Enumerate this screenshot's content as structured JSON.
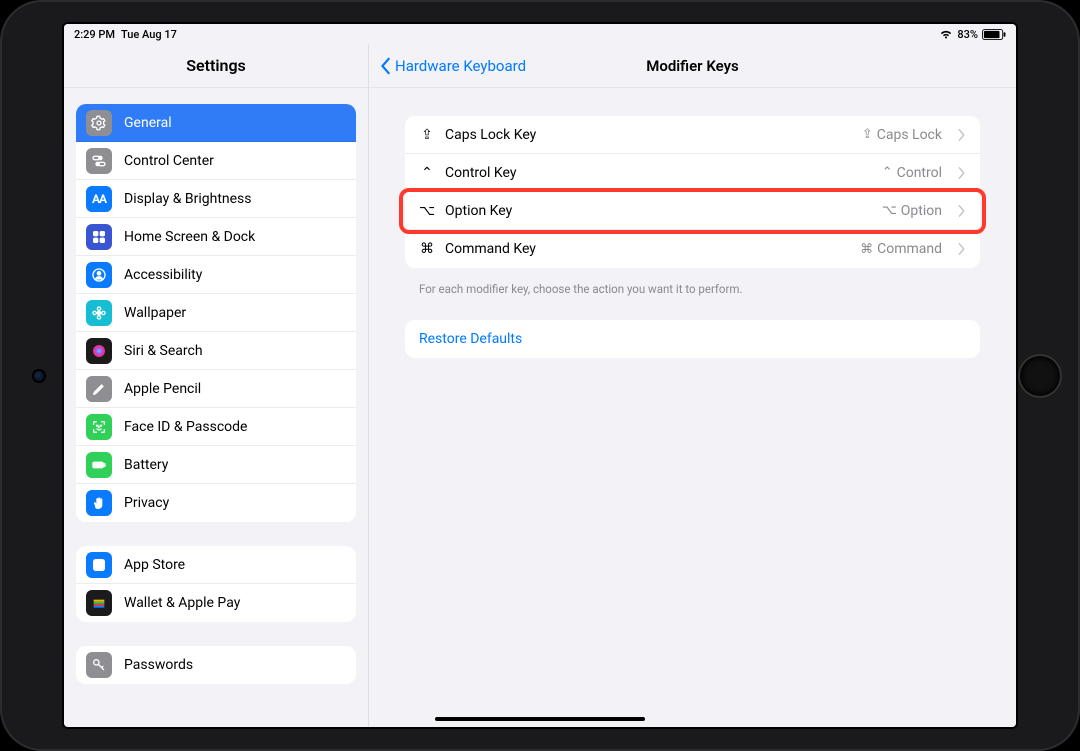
{
  "status": {
    "time": "2:29 PM",
    "date": "Tue Aug 17",
    "battery_text": "83%"
  },
  "sidebar": {
    "title": "Settings",
    "group1": [
      {
        "label": "General",
        "icon": "gear",
        "bg": "#8e8e93",
        "selected": true
      },
      {
        "label": "Control Center",
        "icon": "switches",
        "bg": "#8e8e93"
      },
      {
        "label": "Display & Brightness",
        "icon": "aa",
        "bg": "#0a7aff"
      },
      {
        "label": "Home Screen & Dock",
        "icon": "grid",
        "bg": "#3955d1"
      },
      {
        "label": "Accessibility",
        "icon": "person",
        "bg": "#0a7aff"
      },
      {
        "label": "Wallpaper",
        "icon": "flower",
        "bg": "#17bdd2"
      },
      {
        "label": "Siri & Search",
        "icon": "siri",
        "bg": "#1b1b1d"
      },
      {
        "label": "Apple Pencil",
        "icon": "pencil",
        "bg": "#8e8e93"
      },
      {
        "label": "Face ID & Passcode",
        "icon": "faceid",
        "bg": "#30d158"
      },
      {
        "label": "Battery",
        "icon": "battery",
        "bg": "#30d158"
      },
      {
        "label": "Privacy",
        "icon": "hand",
        "bg": "#0a7aff"
      }
    ],
    "group2": [
      {
        "label": "App Store",
        "icon": "appstore",
        "bg": "#0a7aff"
      },
      {
        "label": "Wallet & Apple Pay",
        "icon": "wallet",
        "bg": "#1b1b1d"
      }
    ],
    "group3": [
      {
        "label": "Passwords",
        "icon": "key",
        "bg": "#8e8e93"
      }
    ]
  },
  "detail": {
    "back_label": "Hardware Keyboard",
    "title": "Modifier Keys",
    "rows": [
      {
        "glyph": "⇪",
        "label": "Caps Lock Key",
        "value_glyph": "⇪",
        "value": "Caps Lock"
      },
      {
        "glyph": "⌃",
        "label": "Control Key",
        "value_glyph": "⌃",
        "value": "Control"
      },
      {
        "glyph": "⌥",
        "label": "Option Key",
        "value_glyph": "⌥",
        "value": "Option",
        "highlighted": true
      },
      {
        "glyph": "⌘",
        "label": "Command Key",
        "value_glyph": "⌘",
        "value": "Command"
      }
    ],
    "footer": "For each modifier key, choose the action you want it to perform.",
    "restore_label": "Restore Defaults"
  }
}
